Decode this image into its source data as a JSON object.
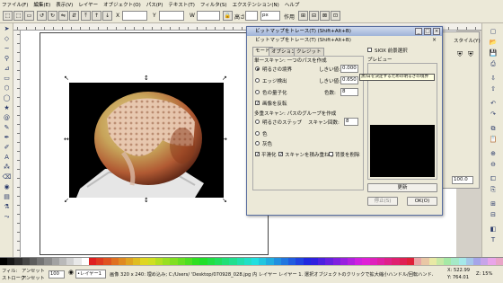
{
  "menu": [
    "ファイル(F)",
    "編集(E)",
    "表示(V)",
    "レイヤー",
    "オブジェクト(O)",
    "パス(P)",
    "テキスト(T)",
    "フィルタ(S)",
    "エクステンション(N)",
    "ヘルプ"
  ],
  "toolctl": {
    "x_label": "X",
    "x_value": "",
    "y_label": "Y",
    "y_value": "",
    "w_label": "W",
    "w_value": "",
    "h_label": "高さ",
    "h_value": "",
    "unit": "px",
    "apply_label": "作用"
  },
  "dialog": {
    "title": "ビットマップをトレース(T) (Shift+Alt+B)",
    "subtitle": "ビットマップをトレース(T) (Shift+Alt+B)",
    "tabs": [
      "モード",
      "オプション",
      "クレジット"
    ],
    "single_scan_title": "単一スキャン: 一つのパスを作成",
    "opt_brightness": "明るさの境界",
    "threshold_label": "しきい値:",
    "threshold_value": "0.000",
    "opt_edge": "エッジ検出",
    "edge_threshold_label": "しきい値:",
    "edge_threshold_value": "0.650",
    "opt_color_quant": "色の量子化",
    "colors_label": "色数:",
    "colors_value": "8",
    "invert_label": "画像を反転",
    "multi_scan_title": "多重スキャン: パスのグループを作成",
    "opt_bright_steps": "明るさのステップ",
    "scans_label": "スキャン回数:",
    "scans_value": "8",
    "opt_color": "色",
    "opt_gray": "灰色",
    "smooth_label": "平滑化",
    "stack_label": "スキャンを積み重ねる",
    "remove_bg_label": "背景を削除",
    "siox_label": "SIOX 前景選択",
    "preview_label": "プレビュー",
    "update_button": "更新",
    "stop_button": "停止(S)",
    "ok_button": "OK(O)",
    "tooltip": "黒/白を決定するための明るさの境界"
  },
  "dock": {
    "style_label": "スタイル(Y)",
    "value_label": "100.0"
  },
  "status": {
    "fill_label": "フィル:",
    "fill_value": "アンセット",
    "stroke_label": "ストローク:",
    "stroke_value": "アンセット",
    "opacity": "100",
    "layer": "•レイヤー1",
    "message": "画像 320 x 240: 埋め込み; C:/Users/ 'Desktop/070928_028.jpg 内 レイヤー レイヤー 1. 選択オブジェクトのクリックで拡大縮小ハンドル/回転ハンドル",
    "x_coord": "X: 522.99",
    "y_coord": "Y: 764.01",
    "zoom": "Z: 15%"
  },
  "colors": {
    "accent": "#9fb3d8",
    "canvas_bg": "#ffffff",
    "chrome_bg": "#ece9d8"
  }
}
